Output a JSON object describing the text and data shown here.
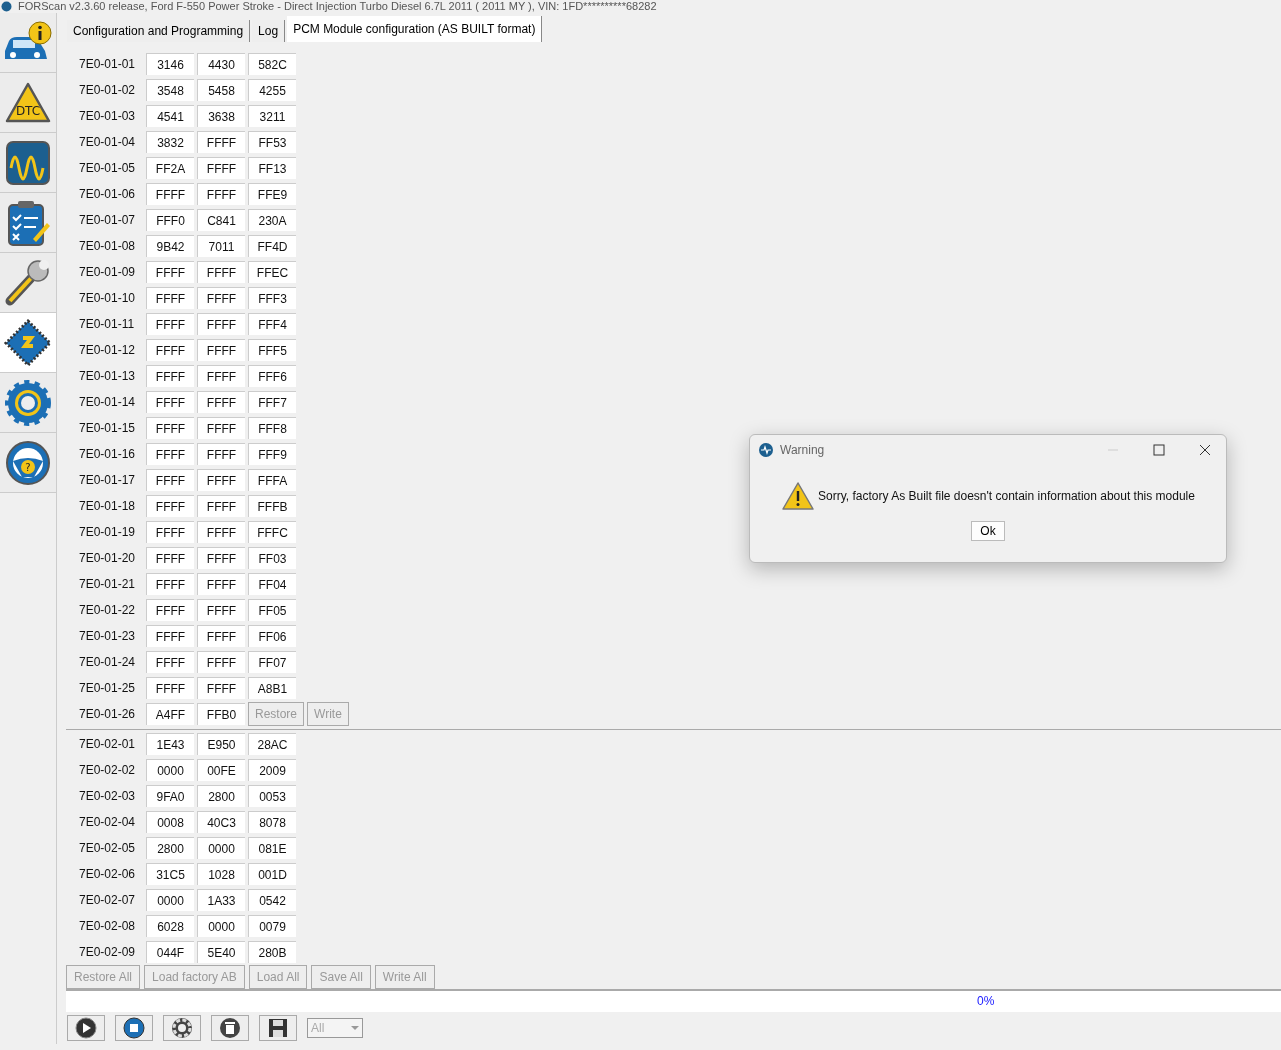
{
  "window": {
    "title": "FORScan v2.3.60 release, Ford F-550 Power Stroke - Direct Injection Turbo Diesel 6.7L 2011 ( 2011 MY ), VIN: 1FD**********68282"
  },
  "sidebar": {
    "items": [
      {
        "kind": "info",
        "selected": false
      },
      {
        "kind": "dtc",
        "label": "DTC",
        "selected": false
      },
      {
        "kind": "scope",
        "selected": false
      },
      {
        "kind": "checklist",
        "selected": false
      },
      {
        "kind": "wrench",
        "selected": false
      },
      {
        "kind": "chip",
        "selected": true
      },
      {
        "kind": "gear",
        "selected": false
      },
      {
        "kind": "help",
        "label": "?",
        "selected": false
      }
    ]
  },
  "tabs": [
    {
      "label": "Configuration and Programming",
      "selected": false
    },
    {
      "label": "Log",
      "selected": false
    },
    {
      "label": "PCM Module configuration (AS BUILT format)",
      "selected": true
    }
  ],
  "groups": [
    {
      "rows": [
        {
          "address": "7E0-01-01",
          "values": [
            "3146",
            "4430",
            "582C"
          ]
        },
        {
          "address": "7E0-01-02",
          "values": [
            "3548",
            "5458",
            "4255"
          ]
        },
        {
          "address": "7E0-01-03",
          "values": [
            "4541",
            "3638",
            "3211"
          ]
        },
        {
          "address": "7E0-01-04",
          "values": [
            "3832",
            "FFFF",
            "FF53"
          ]
        },
        {
          "address": "7E0-01-05",
          "values": [
            "FF2A",
            "FFFF",
            "FF13"
          ]
        },
        {
          "address": "7E0-01-06",
          "values": [
            "FFFF",
            "FFFF",
            "FFE9"
          ]
        },
        {
          "address": "7E0-01-07",
          "values": [
            "FFF0",
            "C841",
            "230A"
          ]
        },
        {
          "address": "7E0-01-08",
          "values": [
            "9B42",
            "7011",
            "FF4D"
          ]
        },
        {
          "address": "7E0-01-09",
          "values": [
            "FFFF",
            "FFFF",
            "FFEC"
          ]
        },
        {
          "address": "7E0-01-10",
          "values": [
            "FFFF",
            "FFFF",
            "FFF3"
          ]
        },
        {
          "address": "7E0-01-11",
          "values": [
            "FFFF",
            "FFFF",
            "FFF4"
          ]
        },
        {
          "address": "7E0-01-12",
          "values": [
            "FFFF",
            "FFFF",
            "FFF5"
          ]
        },
        {
          "address": "7E0-01-13",
          "values": [
            "FFFF",
            "FFFF",
            "FFF6"
          ]
        },
        {
          "address": "7E0-01-14",
          "values": [
            "FFFF",
            "FFFF",
            "FFF7"
          ]
        },
        {
          "address": "7E0-01-15",
          "values": [
            "FFFF",
            "FFFF",
            "FFF8"
          ]
        },
        {
          "address": "7E0-01-16",
          "values": [
            "FFFF",
            "FFFF",
            "FFF9"
          ]
        },
        {
          "address": "7E0-01-17",
          "values": [
            "FFFF",
            "FFFF",
            "FFFA"
          ]
        },
        {
          "address": "7E0-01-18",
          "values": [
            "FFFF",
            "FFFF",
            "FFFB"
          ]
        },
        {
          "address": "7E0-01-19",
          "values": [
            "FFFF",
            "FFFF",
            "FFFC"
          ]
        },
        {
          "address": "7E0-01-20",
          "values": [
            "FFFF",
            "FFFF",
            "FF03"
          ]
        },
        {
          "address": "7E0-01-21",
          "values": [
            "FFFF",
            "FFFF",
            "FF04"
          ]
        },
        {
          "address": "7E0-01-22",
          "values": [
            "FFFF",
            "FFFF",
            "FF05"
          ]
        },
        {
          "address": "7E0-01-23",
          "values": [
            "FFFF",
            "FFFF",
            "FF06"
          ]
        },
        {
          "address": "7E0-01-24",
          "values": [
            "FFFF",
            "FFFF",
            "FF07"
          ]
        },
        {
          "address": "7E0-01-25",
          "values": [
            "FFFF",
            "FFFF",
            "A8B1"
          ]
        },
        {
          "address": "7E0-01-26",
          "values": [
            "A4FF",
            "FFB0"
          ],
          "buttons": [
            {
              "label": "Restore",
              "disabled": true
            },
            {
              "label": "Write",
              "disabled": true
            }
          ]
        }
      ]
    },
    {
      "rows": [
        {
          "address": "7E0-02-01",
          "values": [
            "1E43",
            "E950",
            "28AC"
          ]
        },
        {
          "address": "7E0-02-02",
          "values": [
            "0000",
            "00FE",
            "2009"
          ]
        },
        {
          "address": "7E0-02-03",
          "values": [
            "9FA0",
            "2800",
            "0053"
          ]
        },
        {
          "address": "7E0-02-04",
          "values": [
            "0008",
            "40C3",
            "8078"
          ]
        },
        {
          "address": "7E0-02-05",
          "values": [
            "2800",
            "0000",
            "081E"
          ]
        },
        {
          "address": "7E0-02-06",
          "values": [
            "31C5",
            "1028",
            "001D"
          ]
        },
        {
          "address": "7E0-02-07",
          "values": [
            "0000",
            "1A33",
            "0542"
          ]
        },
        {
          "address": "7E0-02-08",
          "values": [
            "6028",
            "0000",
            "0079"
          ]
        },
        {
          "address": "7E0-02-09",
          "values": [
            "044F",
            "5E40",
            "280B"
          ]
        }
      ]
    }
  ],
  "actions": [
    {
      "label": "Restore All",
      "disabled": true
    },
    {
      "label": "Load factory AB",
      "disabled": true
    },
    {
      "label": "Load All",
      "disabled": true
    },
    {
      "label": "Save All",
      "disabled": true
    },
    {
      "label": "Write All",
      "disabled": true
    }
  ],
  "progress": {
    "level": 0,
    "reading": "0%"
  },
  "toolbar": {
    "buttons": [
      {
        "kind": "play"
      },
      {
        "kind": "stop"
      },
      {
        "kind": "help"
      },
      {
        "kind": "trash"
      },
      {
        "kind": "save"
      }
    ],
    "filter": {
      "value": "All",
      "disabled": true
    }
  },
  "dialog": {
    "title": "Warning",
    "message": "Sorry, factory As Built file doesn't contain information about this module",
    "button": "Ok"
  }
}
